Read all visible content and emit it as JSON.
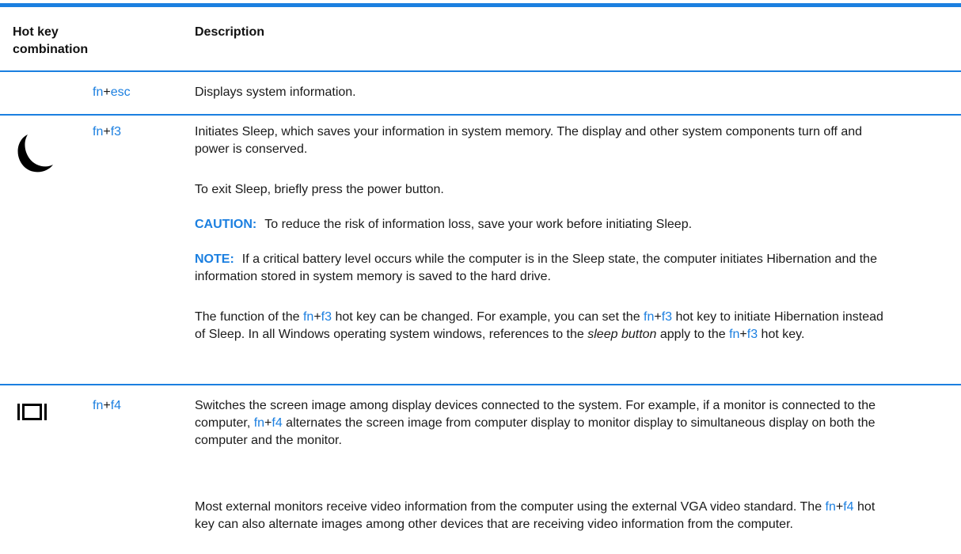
{
  "header": {
    "col1": "Hot key combination",
    "col1_line1": "Hot key",
    "col1_line2": "combination",
    "col2": "Description"
  },
  "rows": [
    {
      "icon": "none",
      "key_fn": "fn",
      "key_plus": "+",
      "key_other": "esc",
      "paragraphs": [
        {
          "text": "Displays system information."
        }
      ]
    },
    {
      "icon": "moon-icon",
      "key_fn": "fn",
      "key_plus": "+",
      "key_other": "f3",
      "paragraphs": [
        {
          "text": "Initiates Sleep, which saves your information in system memory. The display and other system components turn off and power is conserved."
        },
        {
          "text": "To exit Sleep, briefly press the power button."
        },
        {
          "label": "CAUTION:",
          "text": "To reduce the risk of information loss, save your work before initiating Sleep."
        },
        {
          "label": "NOTE:",
          "text": "If a critical battery level occurs while the computer is in the Sleep state, the computer initiates Hibernation and the information stored in system memory is saved to the hard drive."
        },
        {
          "seg1": "The function of the ",
          "k1_fn": "fn",
          "k1_plus": "+",
          "k1_other": "f3",
          "seg2": " hot key can be changed. For example, you can set the ",
          "k2_fn": "fn",
          "k2_plus": "+",
          "k2_other": "f3",
          "seg3": " hot key to initiate Hibernation instead of Sleep. In all Windows operating system windows, references to the ",
          "italic": "sleep button",
          "seg4": " apply to the ",
          "k3_fn": "fn",
          "k3_plus": "+",
          "k3_other": "f3",
          "seg5": " hot key."
        }
      ]
    },
    {
      "icon": "display-switch-icon",
      "key_fn": "fn",
      "key_plus": "+",
      "key_other": "f4",
      "paragraphs": [
        {
          "seg1": "Switches the screen image among display devices connected to the system. For example, if a monitor is connected to the computer, ",
          "k1_fn": "fn",
          "k1_plus": "+",
          "k1_other": "f4",
          "seg2": " alternates the screen image from computer display to monitor display to simultaneous display on both the computer and the monitor."
        },
        {
          "seg1": "Most external monitors receive video information from the computer using the external VGA video standard. The ",
          "k1_fn": "fn",
          "k1_plus": "+",
          "k1_other": "f4",
          "seg2": " hot key can also alternate images among other devices that are receiving video information from the computer."
        }
      ]
    }
  ],
  "colors": {
    "accent": "#1b7fe0",
    "text": "#1a1a1a"
  }
}
